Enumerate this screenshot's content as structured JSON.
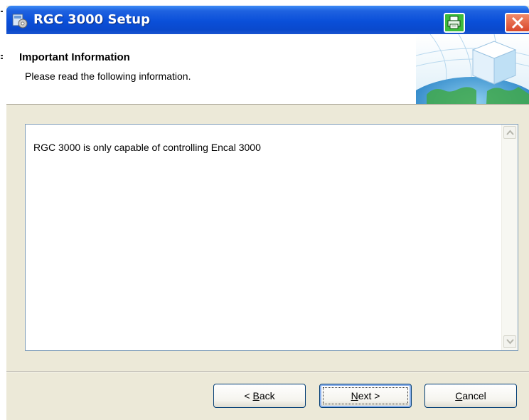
{
  "window": {
    "title": "RGC 3000 Setup"
  },
  "header": {
    "title": "Important Information",
    "subtitle": "Please read the following information."
  },
  "content": {
    "text": "RGC 3000 is only capable of controlling Encal 3000"
  },
  "buttons": {
    "back_prefix": "< ",
    "back_mnemonic": "B",
    "back_rest": "ack",
    "next_mnemonic": "N",
    "next_rest": "ext >",
    "cancel_mnemonic": "C",
    "cancel_rest": "ancel"
  },
  "colors": {
    "titlebar": "#0a4fd9",
    "dialog_face": "#ece9d8",
    "tray_icon": "#3cbb3c",
    "close_button": "#d9472a"
  },
  "icons": {
    "title": "setup-app-icon",
    "tray": "printer-icon",
    "close": "close-icon",
    "header_art": "globe-cube-icon"
  }
}
